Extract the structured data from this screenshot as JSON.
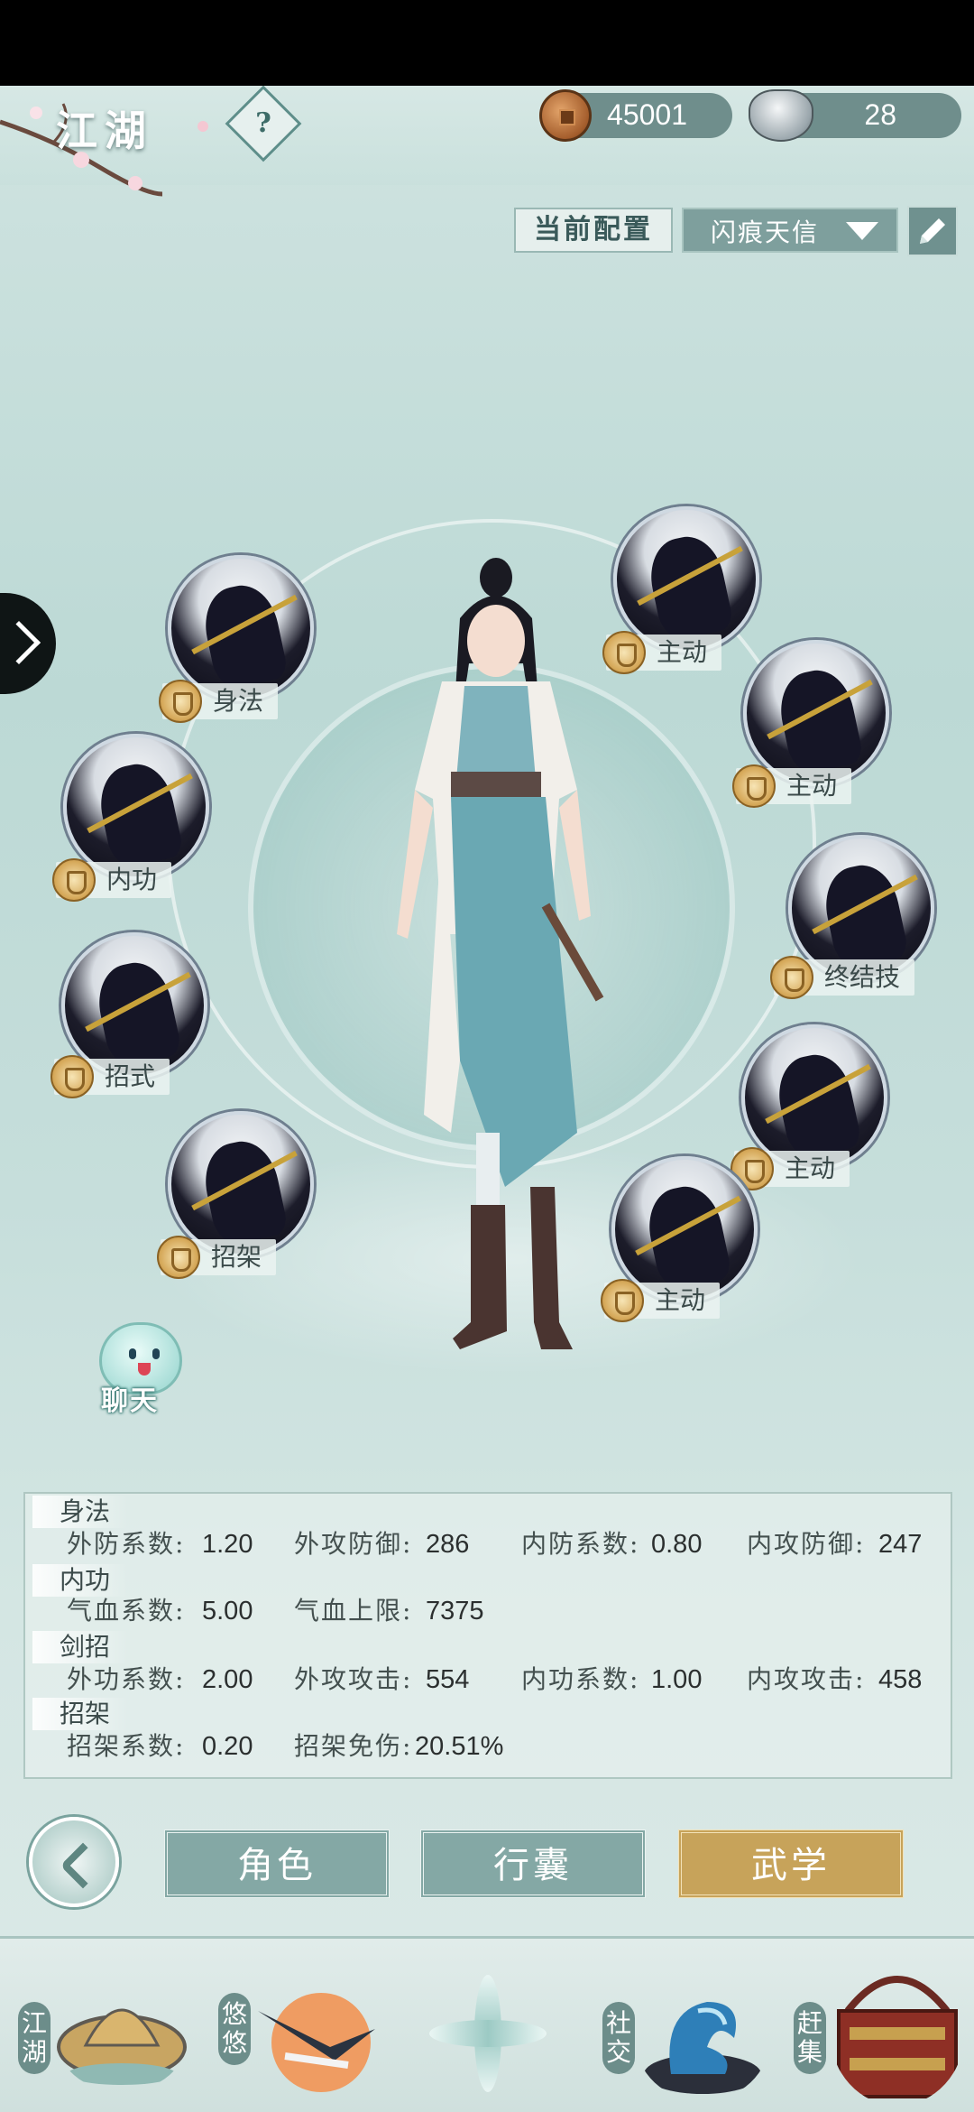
{
  "header": {
    "title": "江湖",
    "help_symbol": "?",
    "copper_amount": "45001",
    "silver_amount": "28"
  },
  "config": {
    "label": "当前配置",
    "selected": "闪痕天信"
  },
  "skills": [
    {
      "label": "身法",
      "kind": "movement"
    },
    {
      "label": "内功",
      "kind": "inner"
    },
    {
      "label": "招式",
      "kind": "stance"
    },
    {
      "label": "招架",
      "kind": "parry"
    },
    {
      "label": "主动",
      "kind": "active"
    },
    {
      "label": "主动",
      "kind": "active"
    },
    {
      "label": "终结技",
      "kind": "finisher"
    },
    {
      "label": "主动",
      "kind": "active"
    },
    {
      "label": "主动",
      "kind": "active"
    }
  ],
  "chat": {
    "label": "聊天"
  },
  "stats": {
    "groups": [
      {
        "head": "身法",
        "items": [
          {
            "name": "外防系数:",
            "value": "1.20"
          },
          {
            "name": "外攻防御:",
            "value": "286"
          },
          {
            "name": "内防系数:",
            "value": "0.80"
          },
          {
            "name": "内攻防御:",
            "value": "247"
          }
        ]
      },
      {
        "head": "内功",
        "items": [
          {
            "name": "气血系数:",
            "value": "5.00"
          },
          {
            "name": "气血上限:",
            "value": "7375"
          }
        ]
      },
      {
        "head": "剑招",
        "items": [
          {
            "name": "外功系数:",
            "value": "2.00"
          },
          {
            "name": "外攻攻击:",
            "value": "554"
          },
          {
            "name": "内功系数:",
            "value": "1.00"
          },
          {
            "name": "内攻攻击:",
            "value": "458"
          }
        ]
      },
      {
        "head": "招架",
        "items": [
          {
            "name": "招架系数:",
            "value": "0.20"
          },
          {
            "name": "招架免伤:",
            "value": "20.51%"
          }
        ]
      }
    ]
  },
  "tabs": {
    "role": "角色",
    "bag": "行囊",
    "martial": "武学",
    "active": "martial"
  },
  "bottom_nav": [
    {
      "label": "江湖",
      "icon": "hat-icon"
    },
    {
      "label": "悠悠",
      "icon": "crane-icon"
    },
    {
      "label": "",
      "icon": "star-icon"
    },
    {
      "label": "社交",
      "icon": "wave-icon"
    },
    {
      "label": "赶集",
      "icon": "basket-icon"
    }
  ],
  "colors": {
    "accent_gold": "#c7a35a",
    "tab_teal": "#84a8a5",
    "background": "#bcd9d5"
  }
}
